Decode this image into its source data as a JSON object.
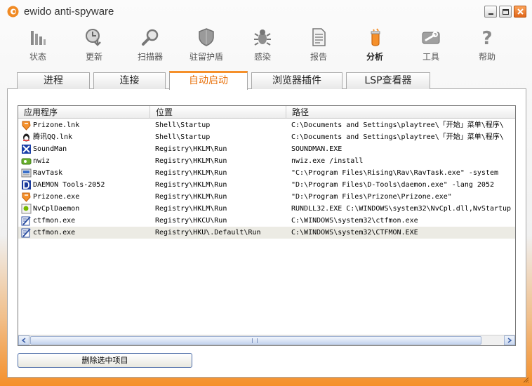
{
  "window": {
    "title": "ewido anti-spyware"
  },
  "toolbar": {
    "items": [
      {
        "label": "状态",
        "icon": "status-icon"
      },
      {
        "label": "更新",
        "icon": "update-icon"
      },
      {
        "label": "扫描器",
        "icon": "scanner-icon"
      },
      {
        "label": "驻留护盾",
        "icon": "shield-icon"
      },
      {
        "label": "感染",
        "icon": "infection-icon"
      },
      {
        "label": "报告",
        "icon": "report-icon"
      },
      {
        "label": "分析",
        "icon": "analysis-icon",
        "active": true
      },
      {
        "label": "工具",
        "icon": "tools-icon"
      },
      {
        "label": "帮助",
        "icon": "help-icon"
      }
    ]
  },
  "tabs": [
    {
      "label": "进程"
    },
    {
      "label": "连接"
    },
    {
      "label": "自动启动",
      "active": true
    },
    {
      "label": "浏览器插件"
    },
    {
      "label": "LSP查看器"
    }
  ],
  "listview": {
    "columns": [
      "应用程序",
      "位置",
      "路径"
    ],
    "rows": [
      {
        "app": "Prizone.lnk",
        "location": "Shell\\Startup",
        "path": "C:\\Documents and Settings\\playtree\\「开始」菜单\\程序\\",
        "icon": "prizone-icon"
      },
      {
        "app": "腾讯QQ.lnk",
        "location": "Shell\\Startup",
        "path": "C:\\Documents and Settings\\playtree\\「开始」菜单\\程序\\",
        "icon": "qq-icon"
      },
      {
        "app": "SoundMan",
        "location": "Registry\\HKLM\\Run",
        "path": "SOUNDMAN.EXE",
        "icon": "soundman-icon"
      },
      {
        "app": "nwiz",
        "location": "Registry\\HKLM\\Run",
        "path": "nwiz.exe /install",
        "icon": "nwiz-icon"
      },
      {
        "app": "RavTask",
        "location": "Registry\\HKLM\\Run",
        "path": "\"C:\\Program Files\\Rising\\Rav\\RavTask.exe\" -system",
        "icon": "ravtask-icon"
      },
      {
        "app": "DAEMON Tools-2052",
        "location": "Registry\\HKLM\\Run",
        "path": "\"D:\\Program Files\\D-Tools\\daemon.exe\"  -lang 2052",
        "icon": "daemon-icon"
      },
      {
        "app": "Prizone.exe",
        "location": "Registry\\HKLM\\Run",
        "path": "\"D:\\Program Files\\Prizone\\Prizone.exe\"",
        "icon": "prizone-icon"
      },
      {
        "app": "NvCplDaemon",
        "location": "Registry\\HKLM\\Run",
        "path": "RUNDLL32.EXE C:\\WINDOWS\\system32\\NvCpl.dll,NvStartup",
        "icon": "nvcpl-icon"
      },
      {
        "app": "ctfmon.exe",
        "location": "Registry\\HKCU\\Run",
        "path": "C:\\WINDOWS\\system32\\ctfmon.exe",
        "icon": "ctfmon-icon"
      },
      {
        "app": "ctfmon.exe",
        "location": "Registry\\HKU\\.Default\\Run",
        "path": "C:\\WINDOWS\\system32\\CTFMON.EXE",
        "icon": "ctfmon-icon",
        "selected": true
      }
    ]
  },
  "delete_button": {
    "label": "删除选中项目"
  },
  "colors": {
    "accent": "#f5902b",
    "accent_text": "#e8730f",
    "selection": "#ecebe4"
  }
}
